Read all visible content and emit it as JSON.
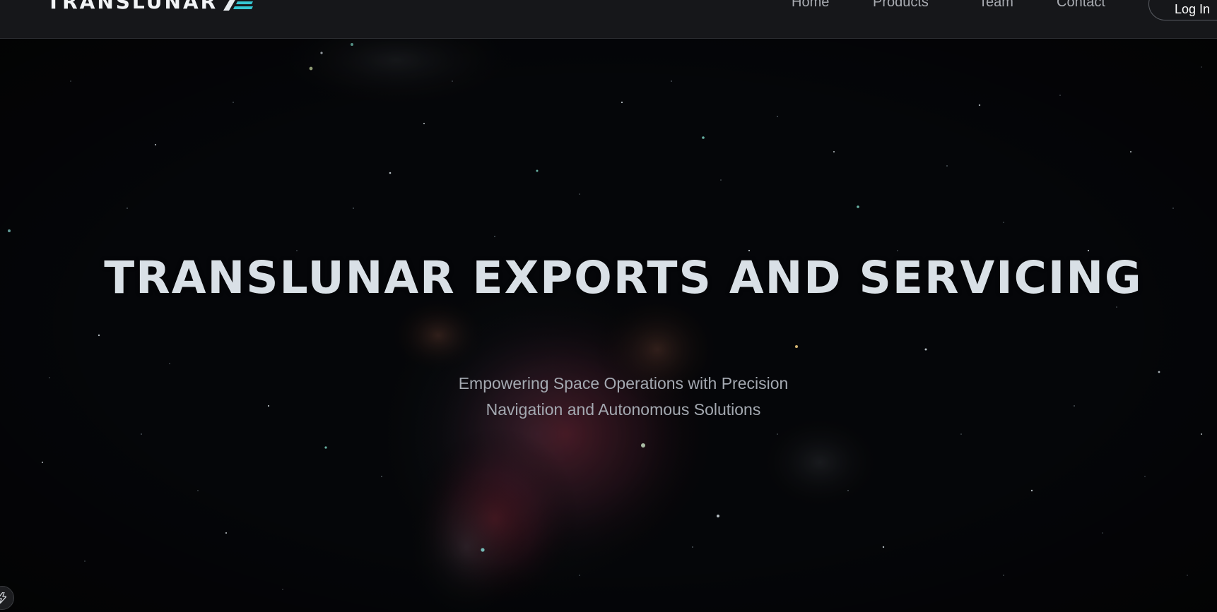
{
  "brand": {
    "name": "TRANSLUNAR",
    "logo_icon": "chevron-stripes-logo-icon"
  },
  "nav": {
    "links": [
      {
        "label": "Home"
      },
      {
        "label": "Products"
      },
      {
        "label": "Team"
      },
      {
        "label": "Contact"
      }
    ],
    "login_label": "Log In"
  },
  "hero": {
    "title": "TRANSLUNAR EXPORTS AND SERVICING",
    "subtitle_line1": "Empowering Space Operations with Precision",
    "subtitle_line2": "Navigation and Autonomous Solutions",
    "background": "orion-nebula-starfield"
  },
  "corner_widget": {
    "icon": "lightning-bolt-icon"
  },
  "colors": {
    "nav_bg": "#16171a",
    "accent_cyan": "#35c7d3",
    "title_text": "#d9e0e6",
    "subtitle_text": "#a4a9b1"
  }
}
